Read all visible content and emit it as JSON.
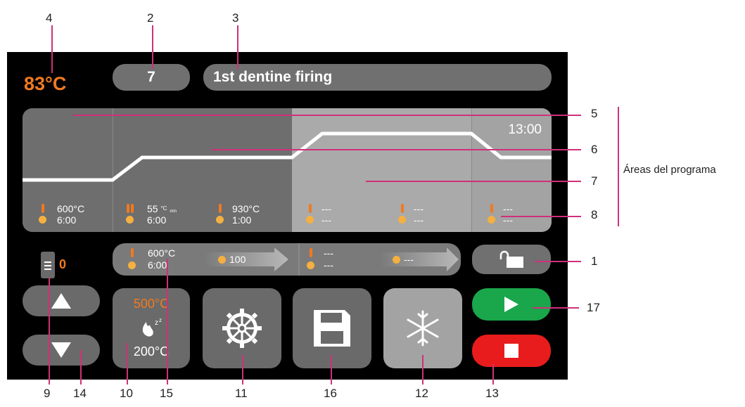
{
  "callouts": {
    "top": [
      "4",
      "2",
      "3"
    ],
    "right": [
      "5",
      "6",
      "7",
      "8",
      "1",
      "17"
    ],
    "bottom": [
      "9",
      "14",
      "10",
      "15",
      "11",
      "16",
      "12",
      "13"
    ],
    "areas_label": "Áreas del programa"
  },
  "header": {
    "current_temp": "83°C",
    "program_number": "7",
    "program_name": "1st dentine firing"
  },
  "program_area": {
    "time": "13:00",
    "segments": [
      {
        "temp": "600°C",
        "time": "6:00"
      },
      {
        "temp": "55",
        "temp_unit": "°C",
        "temp_sub": "min",
        "time": "6:00"
      },
      {
        "temp": "930°C",
        "time": "1:00"
      },
      {
        "temp": "---",
        "time": "---"
      },
      {
        "temp": "---",
        "time": "---"
      },
      {
        "temp": "---",
        "time": "---"
      }
    ]
  },
  "controls": {
    "counter": "0",
    "step1": {
      "temp": "600°C",
      "time": "6:00",
      "vacuum": "100"
    },
    "step2": {
      "temp": "---",
      "time": "---",
      "vacuum": "---"
    },
    "standby_top": "500°C",
    "standby_bottom": "200°C"
  },
  "icons": {
    "up": "arrow-up-icon",
    "down": "arrow-down-icon",
    "lock": "lock-open-icon",
    "settings": "gear-icon",
    "save": "floppy-disk-icon",
    "cool": "snowflake-icon",
    "play": "play-icon",
    "stop": "stop-icon",
    "flame": "flame-icon"
  },
  "colors": {
    "accent_orange": "#f07a20",
    "start_green": "#1aa64a",
    "stop_red": "#e81c1c",
    "callout_line": "#d0307a"
  }
}
